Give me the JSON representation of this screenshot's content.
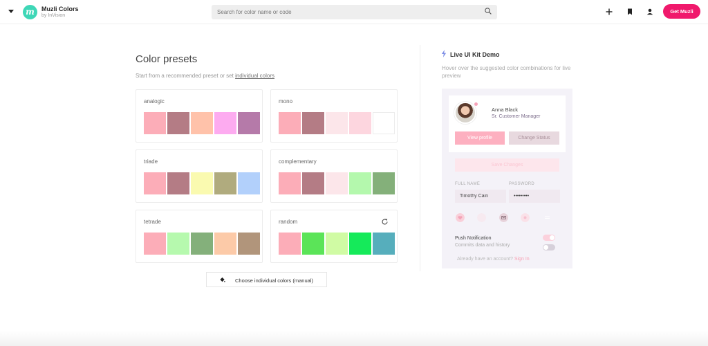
{
  "header": {
    "brand_title": "Muzli Colors",
    "brand_sub": "by InVision",
    "logo_letter": "m",
    "search_placeholder": "Search for color name or code",
    "cta_label": "Get Muzli",
    "accent": "#f0196c"
  },
  "presets": {
    "title": "Color presets",
    "subtitle_prefix": "Start from a recommended preset or set ",
    "subtitle_link": "individual colors",
    "cards": [
      {
        "label": "analogic",
        "colors": [
          "#fcadb8",
          "#b47c85",
          "#ffc2aa",
          "#fdabf0",
          "#b57aa9"
        ]
      },
      {
        "label": "mono",
        "colors": [
          "#fcadb8",
          "#b47c85",
          "#fce6ea",
          "#fdd6df",
          "#ffffff"
        ]
      },
      {
        "label": "triade",
        "colors": [
          "#fcadb8",
          "#b47c85",
          "#fafab0",
          "#b0ab7e",
          "#b2d0fb"
        ]
      },
      {
        "label": "complementary",
        "colors": [
          "#fcadb8",
          "#b47c85",
          "#fce6ea",
          "#b4f8ad",
          "#84b07a"
        ]
      },
      {
        "label": "tetrade",
        "colors": [
          "#fcadb8",
          "#b6f9ae",
          "#84b07b",
          "#fccaa8",
          "#b1957b"
        ]
      },
      {
        "label": "random",
        "colors": [
          "#fcadb8",
          "#5be458",
          "#d0fba4",
          "#15ea5a",
          "#56aebc"
        ]
      }
    ],
    "manual_button": "Choose individual colors (manual)"
  },
  "kit": {
    "title": "Live UI Kit Demo",
    "subtitle": "Hover over the suggested color combinations for live preview",
    "profile_name": "Anna Black",
    "profile_role": "Sr. Customer Manager",
    "view_profile": "View profile",
    "change_status": "Change Status",
    "save_changes": "Save Changes",
    "full_name_label": "FULL NAME",
    "password_label": "PASSWORD",
    "full_name_value": "Timothy Cain",
    "password_value": "•••••••••",
    "push_title": "Push Notification",
    "push_sub": "Commits data and history",
    "signin_prefix": "Already have an account? ",
    "signin_link": "Sign In"
  }
}
